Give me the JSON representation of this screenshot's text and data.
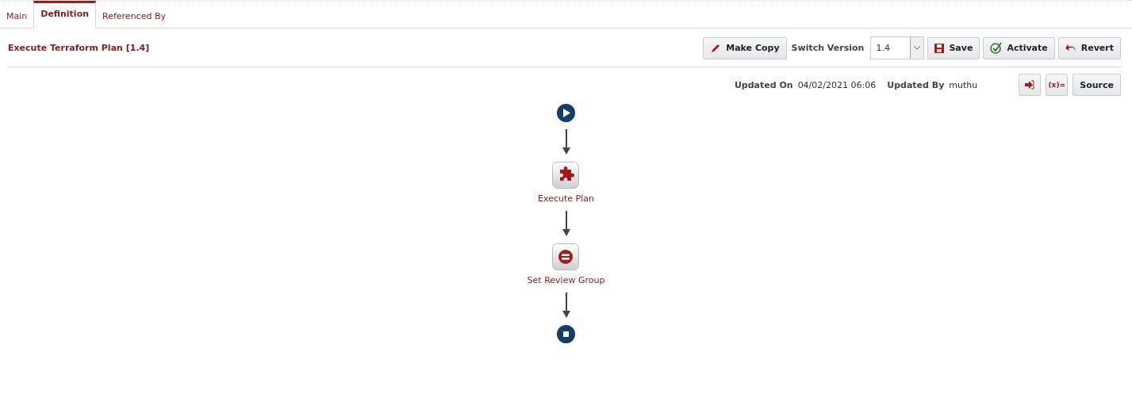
{
  "tabs": [
    {
      "label": "Main",
      "selected": false
    },
    {
      "label": "Definition",
      "selected": true
    },
    {
      "label": "Referenced By",
      "selected": false
    }
  ],
  "header": {
    "title": "Execute Terraform Plan [1.4]",
    "make_copy": "Make Copy",
    "switch_version_label": "Switch Version",
    "version": "1.4",
    "save": "Save",
    "activate": "Activate",
    "revert": "Revert"
  },
  "info": {
    "updated_on_label": "Updated On",
    "updated_on": "04/02/2021 06:06",
    "updated_by_label": "Updated By",
    "updated_by": "muthu",
    "variables": "(x)=",
    "source": "Source"
  },
  "flow": [
    {
      "kind": "start"
    },
    {
      "kind": "task",
      "label": "Execute Plan"
    },
    {
      "kind": "set",
      "label": "Set Review Group"
    },
    {
      "kind": "end"
    }
  ]
}
